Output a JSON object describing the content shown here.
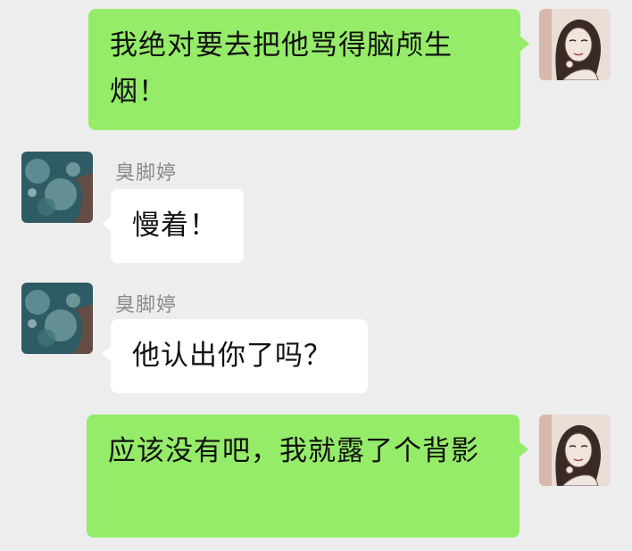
{
  "messages": [
    {
      "sender": "self",
      "text": "我绝对要去把他骂得脑颅生烟！"
    },
    {
      "sender": "臭脚婷",
      "nickname": "臭脚婷",
      "text": "慢着！"
    },
    {
      "sender": "臭脚婷",
      "nickname": "臭脚婷",
      "text": "他认出你了吗？"
    },
    {
      "sender": "self",
      "text": "应该没有吧，我就露了个背影"
    }
  ],
  "colors": {
    "background": "#ededed",
    "outgoing_bubble": "#95ec69",
    "incoming_bubble": "#ffffff",
    "nickname_text": "#8a8a8a"
  },
  "icons": {
    "self_avatar": "woman-portrait-sketch-avatar",
    "friend_avatar": "underwater-photo-avatar"
  }
}
